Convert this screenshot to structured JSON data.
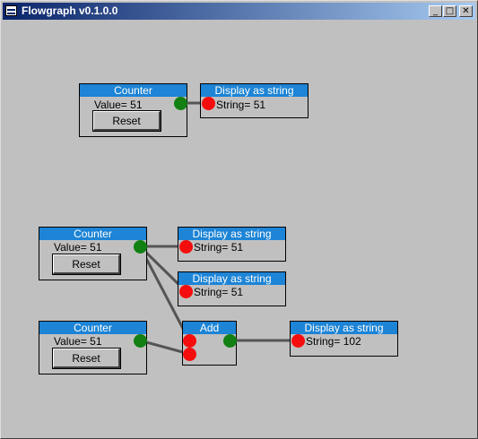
{
  "window": {
    "title": "Flowgraph v0.1.0.0",
    "controls": {
      "minimize": "_",
      "maximize": "□",
      "close": "✕"
    }
  },
  "nodes": {
    "counter1": {
      "title": "Counter",
      "value_text": "Value= 51",
      "button": "Reset"
    },
    "display1": {
      "title": "Display as string",
      "text": "String= 51"
    },
    "counter2": {
      "title": "Counter",
      "value_text": "Value= 51",
      "button": "Reset"
    },
    "display2": {
      "title": "Display as string",
      "text": "String= 51"
    },
    "display3": {
      "title": "Display as string",
      "text": "String= 51"
    },
    "counter3": {
      "title": "Counter",
      "value_text": "Value= 51",
      "button": "Reset"
    },
    "add1": {
      "title": "Add"
    },
    "display4": {
      "title": "Display as string",
      "text": "String= 102"
    }
  },
  "colors": {
    "node_header": "#1d84d6",
    "output_port": "#128012",
    "input_port": "#f50d0d",
    "wire": "#555555"
  }
}
